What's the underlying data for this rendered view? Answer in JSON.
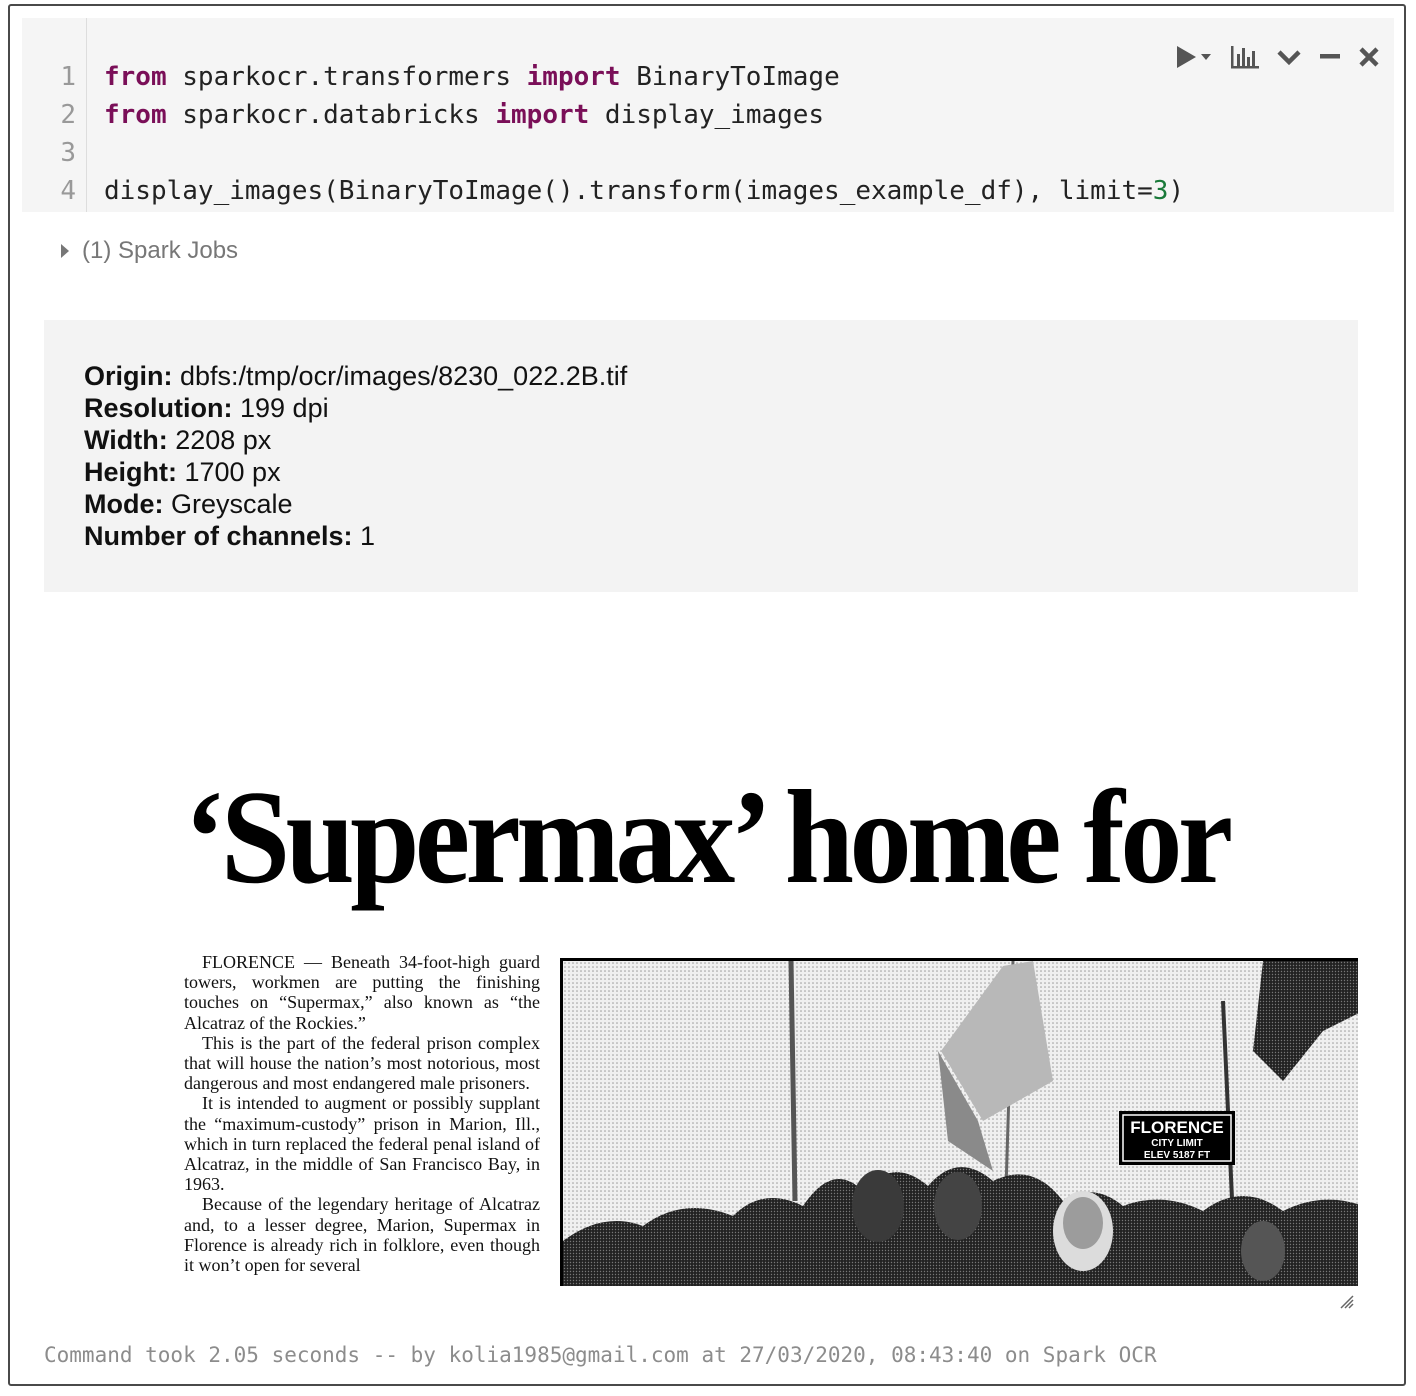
{
  "code": {
    "line_numbers": [
      "1",
      "2",
      "3",
      "4"
    ],
    "line1": {
      "kw1": "from",
      "module": " sparkocr.transformers ",
      "kw2": "import",
      "name": " BinaryToImage"
    },
    "line2": {
      "kw1": "from",
      "module": " sparkocr.databricks ",
      "kw2": "import",
      "name": " display_images"
    },
    "line4": {
      "before": "display_images(BinaryToImage().transform(images_example_df), limit=",
      "num": "3",
      "after": ")"
    }
  },
  "toolbar": {
    "icons": [
      "run-icon",
      "chart-icon",
      "chevron-down-icon",
      "minimize-icon",
      "close-icon"
    ]
  },
  "spark_jobs": {
    "label": "(1) Spark Jobs"
  },
  "image_info": {
    "origin_label": "Origin:",
    "origin_value": " dbfs:/tmp/ocr/images/8230_022.2B.tif",
    "resolution_label": "Resolution:",
    "resolution_value": " 199 dpi",
    "width_label": "Width:",
    "width_value": " 2208 px",
    "height_label": "Height:",
    "height_value": " 1700 px",
    "mode_label": "Mode:",
    "mode_value": " Greyscale",
    "channels_label": "Number of channels:",
    "channels_value": " 1"
  },
  "scan": {
    "headline": "‘Supermax’ home for",
    "paragraphs": [
      "FLORENCE — Beneath 34-foot-high guard towers, workmen are putting the finishing touches on “Supermax,” also known as “the Alcatraz of the Rockies.”",
      "This is the part of the federal prison complex that will house the nation’s most notorious, most dangerous and most endangered male prisoners.",
      "It is intended to augment or possibly supplant the “maximum-custody” prison in Marion, Ill., which in turn replaced the federal penal island of Alcatraz, in the middle of San Francisco Bay, in 1963.",
      "Because of the legendary heritage of Alcatraz and, to a lesser degree, Marion, Supermax in Florence is already rich in folklore, even though it won’t open for several"
    ],
    "sign": {
      "line1": "FLORENCE",
      "line2": "CITY LIMIT",
      "line3": "ELEV 5187 FT"
    }
  },
  "footer": {
    "text": "Command took 2.05 seconds -- by kolia1985@gmail.com at 27/03/2020, 08:43:40 on Spark OCR"
  }
}
